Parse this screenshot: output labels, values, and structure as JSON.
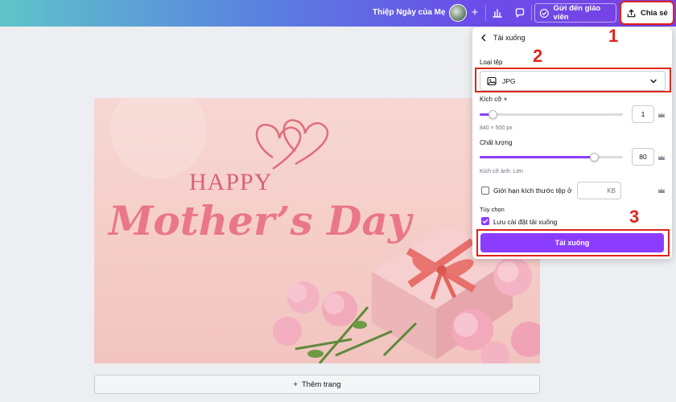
{
  "topbar": {
    "doc_title": "Thiệp Ngày của Mẹ",
    "teacher_button": "Gửi đến giáo viên",
    "share_button": "Chia sẻ"
  },
  "canvas": {
    "happy_text": "HAPPY",
    "mothers_day_text": "Mother’s Day"
  },
  "add_page": {
    "label": "Thêm trang"
  },
  "panel": {
    "title": "Tải xuống",
    "file_type_label": "Loại tệp",
    "file_type_value": "JPG",
    "size_label": "Kích cỡ ×",
    "size_value": "1",
    "size_fraction": 0.09,
    "size_dims": "840 × 500 px",
    "quality_label": "Chất lượng",
    "quality_value": "80",
    "quality_fraction": 0.8,
    "file_size_note": "Kích cỡ ảnh: Lớn",
    "limit_label": "Giới hạn kích thước tệp ở",
    "limit_unit": "KB",
    "options_label": "Tùy chọn",
    "save_settings_label": "Lưu cài đặt tải xuống",
    "download_button": "Tải xuống"
  },
  "annotations": {
    "n1": "1",
    "n2": "2",
    "n3": "3"
  },
  "colors": {
    "accent": "#8b3dff",
    "annotation": "#e0241b",
    "title_pink": "#e9717f"
  }
}
